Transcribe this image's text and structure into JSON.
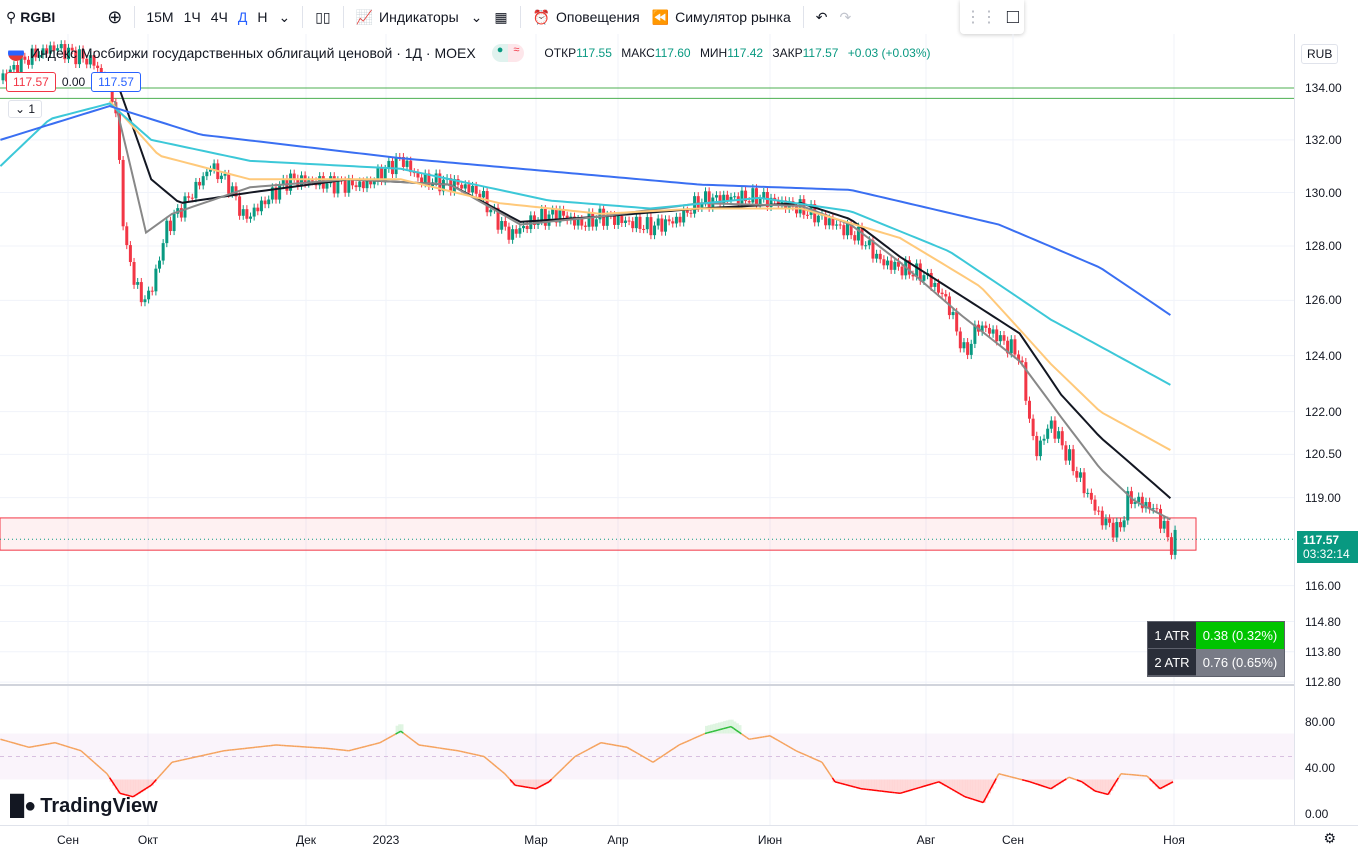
{
  "toolbar": {
    "symbol": "RGBI",
    "timeframes": [
      "15М",
      "1Ч",
      "4Ч",
      "Д",
      "Н"
    ],
    "active_timeframe": "Д",
    "indicators": "Индикаторы",
    "alerts": "Оповещения",
    "replay": "Симулятор рынка"
  },
  "legend": {
    "title": "Индекс Мосбиржи государственных облигаций ценовой · 1Д · MOEX",
    "open_label": "ОТКР",
    "open": "117.55",
    "high_label": "МАКС",
    "high": "117.60",
    "low_label": "МИН",
    "low": "117.42",
    "close_label": "ЗАКР",
    "close": "117.57",
    "change": "+0.03 (+0.03%)",
    "bid": "117.57",
    "spread": "0.00",
    "ask": "117.57",
    "collapse": "1"
  },
  "price_scale": {
    "currency": "RUB",
    "labels": [
      "134.00",
      "132.00",
      "130.00",
      "128.00",
      "126.00",
      "124.00",
      "122.00",
      "120.50",
      "119.00",
      "116.00",
      "114.80",
      "113.80",
      "112.80"
    ],
    "last_price": "117.57",
    "countdown": "03:32:14"
  },
  "rsi_scale": {
    "labels": [
      "80.00",
      "40.00",
      "0.00"
    ]
  },
  "atr": [
    {
      "label": "1 ATR",
      "value": "0.38 (0.32%)",
      "color": "#00c400"
    },
    {
      "label": "2 ATR",
      "value": "0.76 (0.65%)",
      "color": "#787b86"
    }
  ],
  "time_axis": [
    "Сен",
    "Окт",
    "Дек",
    "2023",
    "Мар",
    "Апр",
    "Июн",
    "Авг",
    "Сен",
    "Ноя"
  ],
  "brand": "TradingView",
  "colors": {
    "up": "#089981",
    "down": "#f23645",
    "ma_black": "#131722",
    "ma_gray": "#888888",
    "ma_orange": "#ffc97a",
    "ma_cyan": "#3cc8d8",
    "ma_blue": "#3a6ff2",
    "rsi": "#f5a25d"
  },
  "chart_data": {
    "type": "line",
    "x_unit": "days since 2022-09-01",
    "price_path": [
      [
        -26,
        134.3
      ],
      [
        -15,
        135.2
      ],
      [
        -5,
        135.6
      ],
      [
        10,
        135.0
      ],
      [
        18,
        133.5
      ],
      [
        22,
        128
      ],
      [
        28,
        126
      ],
      [
        32,
        126.3
      ],
      [
        38,
        128.7
      ],
      [
        45,
        129.6
      ],
      [
        55,
        131.0
      ],
      [
        62,
        130.3
      ],
      [
        68,
        129.0
      ],
      [
        75,
        129.6
      ],
      [
        85,
        130.5
      ],
      [
        95,
        130.4
      ],
      [
        105,
        130.3
      ],
      [
        115,
        130.3
      ],
      [
        128,
        131.3
      ],
      [
        135,
        130.5
      ],
      [
        150,
        130.3
      ],
      [
        158,
        130.0
      ],
      [
        165,
        129.0
      ],
      [
        170,
        128.4
      ],
      [
        180,
        129.0
      ],
      [
        189,
        129.2
      ],
      [
        197,
        128.8
      ],
      [
        205,
        129.1
      ],
      [
        215,
        128.9
      ],
      [
        224,
        128.7
      ],
      [
        235,
        129.0
      ],
      [
        243,
        129.7
      ],
      [
        255,
        129.8
      ],
      [
        266,
        129.8
      ],
      [
        282,
        129.4
      ],
      [
        295,
        128.8
      ],
      [
        305,
        128.3
      ],
      [
        313,
        127.4
      ],
      [
        320,
        127.2
      ],
      [
        330,
        126.9
      ],
      [
        338,
        126.0
      ],
      [
        345,
        124.0
      ],
      [
        350,
        125.1
      ],
      [
        356,
        124.8
      ],
      [
        366,
        124.0
      ],
      [
        372,
        120.5
      ],
      [
        378,
        121.6
      ],
      [
        387,
        120.0
      ],
      [
        397,
        118.3
      ],
      [
        404,
        117.8
      ],
      [
        408,
        119.0
      ],
      [
        418,
        118.6
      ],
      [
        422,
        117.9
      ],
      [
        424,
        117.3
      ],
      [
        426,
        117.57
      ]
    ],
    "series": [
      {
        "name": "MA black",
        "color": "#131722",
        "points": [
          [
            20,
            133.9
          ],
          [
            32,
            130.5
          ],
          [
            43,
            129.6
          ],
          [
            70,
            130.0
          ],
          [
            108,
            130.5
          ],
          [
            147,
            130.3
          ],
          [
            174,
            128.9
          ],
          [
            205,
            129.1
          ],
          [
            243,
            129.4
          ],
          [
            282,
            129.6
          ],
          [
            301,
            129.0
          ],
          [
            320,
            127.6
          ],
          [
            343,
            126.2
          ],
          [
            366,
            124.8
          ],
          [
            382,
            122.6
          ],
          [
            397,
            121.1
          ],
          [
            425,
            118.9
          ]
        ]
      },
      {
        "name": "MA gray",
        "color": "#888888",
        "points": [
          [
            18,
            133.5
          ],
          [
            30,
            128.5
          ],
          [
            40,
            129.2
          ],
          [
            70,
            130.2
          ],
          [
            108,
            130.5
          ],
          [
            147,
            130.3
          ],
          [
            174,
            128.8
          ],
          [
            205,
            129.1
          ],
          [
            243,
            129.6
          ],
          [
            282,
            129.5
          ],
          [
            301,
            128.8
          ],
          [
            320,
            127.4
          ],
          [
            343,
            125.5
          ],
          [
            366,
            123.8
          ],
          [
            382,
            121.8
          ],
          [
            397,
            120.0
          ],
          [
            410,
            118.9
          ],
          [
            425,
            118.2
          ]
        ]
      },
      {
        "name": "MA orange",
        "color": "#ffc97a",
        "points": [
          [
            16,
            133.5
          ],
          [
            35,
            131.4
          ],
          [
            70,
            130.5
          ],
          [
            128,
            130.5
          ],
          [
            166,
            129.6
          ],
          [
            205,
            129.2
          ],
          [
            243,
            129.4
          ],
          [
            282,
            129.4
          ],
          [
            320,
            128.3
          ],
          [
            351,
            126.5
          ],
          [
            378,
            123.7
          ],
          [
            397,
            122.0
          ],
          [
            425,
            120.6
          ]
        ]
      },
      {
        "name": "MA cyan",
        "color": "#3cc8d8",
        "points": [
          [
            -26,
            131.0
          ],
          [
            -7,
            132.8
          ],
          [
            16,
            133.4
          ],
          [
            32,
            132.0
          ],
          [
            70,
            131.2
          ],
          [
            128,
            130.9
          ],
          [
            185,
            129.7
          ],
          [
            224,
            129.4
          ],
          [
            266,
            129.8
          ],
          [
            301,
            129.3
          ],
          [
            339,
            127.8
          ],
          [
            378,
            125.3
          ],
          [
            425,
            122.9
          ]
        ]
      },
      {
        "name": "MA blue",
        "color": "#3a6ff2",
        "points": [
          [
            -26,
            132.0
          ],
          [
            16,
            133.3
          ],
          [
            51,
            132.2
          ],
          [
            128,
            131.3
          ],
          [
            243,
            130.3
          ],
          [
            301,
            130.1
          ],
          [
            358,
            128.8
          ],
          [
            397,
            127.2
          ],
          [
            425,
            125.4
          ]
        ]
      }
    ],
    "rsi": {
      "name": "RSI",
      "overbought": 70,
      "oversold": 30,
      "points": [
        [
          -26,
          65
        ],
        [
          -15,
          58
        ],
        [
          -5,
          62
        ],
        [
          5,
          55
        ],
        [
          15,
          35
        ],
        [
          20,
          18
        ],
        [
          25,
          15
        ],
        [
          32,
          25
        ],
        [
          40,
          45
        ],
        [
          60,
          55
        ],
        [
          80,
          60
        ],
        [
          100,
          57
        ],
        [
          108,
          55
        ],
        [
          120,
          62
        ],
        [
          128,
          72
        ],
        [
          135,
          60
        ],
        [
          150,
          55
        ],
        [
          160,
          50
        ],
        [
          168,
          35
        ],
        [
          172,
          25
        ],
        [
          180,
          22
        ],
        [
          185,
          28
        ],
        [
          195,
          50
        ],
        [
          205,
          62
        ],
        [
          215,
          58
        ],
        [
          225,
          45
        ],
        [
          235,
          60
        ],
        [
          245,
          70
        ],
        [
          255,
          76
        ],
        [
          262,
          65
        ],
        [
          270,
          68
        ],
        [
          280,
          55
        ],
        [
          290,
          45
        ],
        [
          295,
          28
        ],
        [
          305,
          22
        ],
        [
          320,
          18
        ],
        [
          335,
          28
        ],
        [
          345,
          15
        ],
        [
          352,
          10
        ],
        [
          358,
          35
        ],
        [
          370,
          28
        ],
        [
          378,
          22
        ],
        [
          385,
          32
        ],
        [
          390,
          28
        ],
        [
          395,
          20
        ],
        [
          400,
          17
        ],
        [
          405,
          35
        ],
        [
          415,
          33
        ],
        [
          420,
          22
        ],
        [
          425,
          28
        ]
      ]
    },
    "zones": {
      "support_low": 117.2,
      "support_high": 118.3,
      "resistance_lines": [
        134.0,
        133.6
      ]
    }
  }
}
